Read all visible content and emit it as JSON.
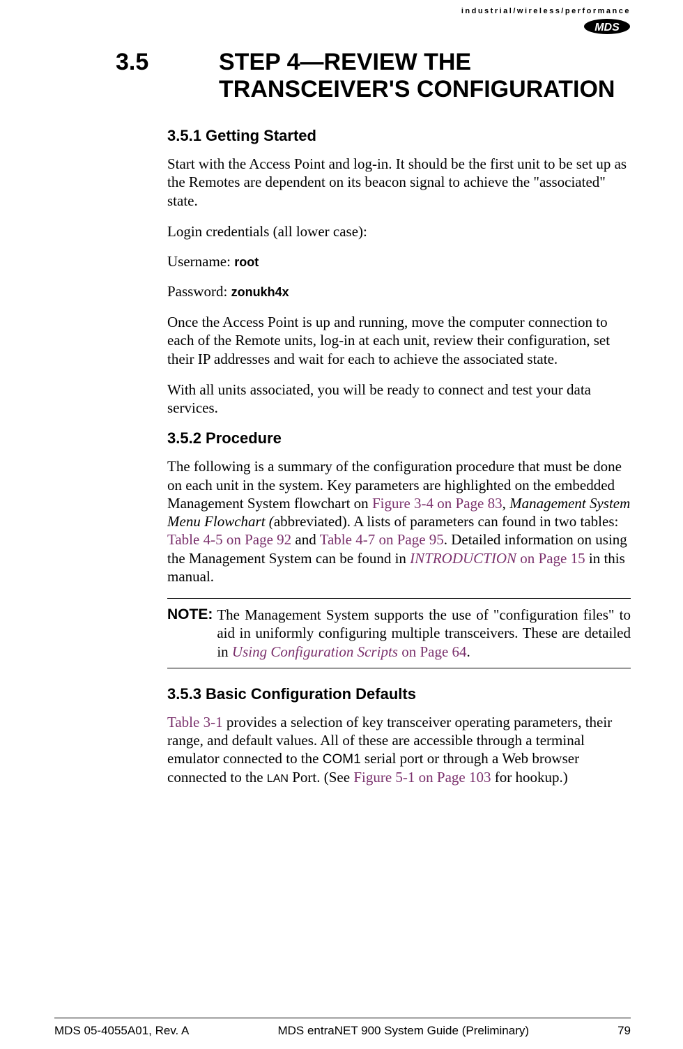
{
  "header": {
    "tagline": "industrial/wireless/performance",
    "logo_text": "MDS"
  },
  "section": {
    "number": "3.5",
    "title": "STEP 4—REVIEW THE TRANSCEIVER'S CONFIGURATION"
  },
  "sub1": {
    "heading": "3.5.1 Getting Started",
    "p1": "Start with the Access Point and log-in. It should be the first unit to be set up as the Remotes are dependent on its beacon signal to achieve the \"associated\" state.",
    "p2": "Login credentials (all lower case):",
    "username_label": "Username: ",
    "username_value": "root",
    "password_label": "Password: ",
    "password_value": "zonukh4x",
    "p3": "Once the Access Point is up and running, move the computer connection to each of the Remote units, log-in at each unit, review their configuration, set their IP addresses and wait for each to achieve the associated state.",
    "p4": "With all units associated, you will be ready to connect and test your data services."
  },
  "sub2": {
    "heading": "3.5.2 Procedure",
    "p1_a": "The following is a summary of the configuration procedure that must be done on each unit in the system. Key parameters are highlighted on the embedded Management System flowchart on ",
    "p1_xref1": "Figure 3-4 on Page 83",
    "p1_b": ", ",
    "p1_italic": "Management System Menu Flowchart (",
    "p1_c": "abbreviated). A lists of parameters can found in two tables: ",
    "p1_xref2": "Table 4-5 on Page 92",
    "p1_d": " and ",
    "p1_xref3": "Table 4-7 on Page 95",
    "p1_e": ". Detailed information on using the Management System can be found in ",
    "p1_xref4_italic": "INTRODUCTION",
    "p1_xref4_rest": " on Page 15",
    "p1_f": " in this manual.",
    "note_label": "NOTE:",
    "note_a": "The Management System supports the use of \"configuration files\" to aid in uniformly configuring multiple transceivers. These are detailed in ",
    "note_xref_italic": "Using Configuration Scripts",
    "note_xref_rest": " on Page 64",
    "note_b": "."
  },
  "sub3": {
    "heading": "3.5.3 Basic Configuration Defaults",
    "p1_xref1": "Table 3-1",
    "p1_a": " provides a selection of key transceiver operating parameters, their range, and default values. All of these are accessible through a terminal emulator connected to the ",
    "p1_com1": "COM1",
    "p1_b": " serial port or through a Web browser connected to the ",
    "p1_lan": "LAN",
    "p1_c": " Port. (See ",
    "p1_xref2": "Figure 5-1 on Page 103",
    "p1_d": " for hookup.)"
  },
  "footer": {
    "left": "MDS 05-4055A01, Rev. A",
    "center": "MDS entraNET 900 System Guide (Preliminary)",
    "right": "79"
  }
}
